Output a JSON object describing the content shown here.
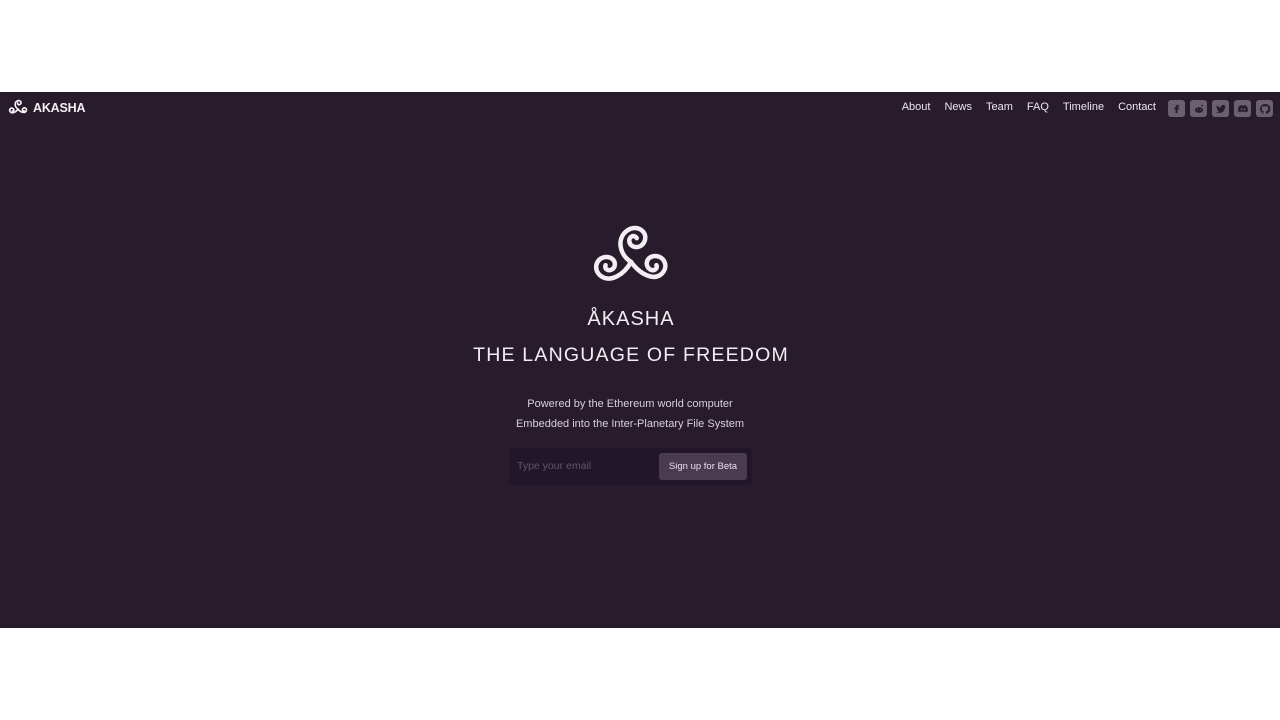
{
  "brand": {
    "name": "AKASHA",
    "logo_icon": "triskelion-icon"
  },
  "nav": {
    "links": [
      "About",
      "News",
      "Team",
      "FAQ",
      "Timeline",
      "Contact"
    ]
  },
  "social": [
    "facebook-icon",
    "reddit-icon",
    "twitter-icon",
    "discord-icon",
    "github-icon"
  ],
  "hero": {
    "name": "ÅKASHA",
    "tagline": "THE LANGUAGE OF FREEDOM",
    "subtitle_1": "Powered by the Ethereum world computer",
    "subtitle_2": "Embedded into the Inter-Planetary File System"
  },
  "signup": {
    "email_placeholder": "Type your email",
    "button_label": "Sign up for Beta"
  },
  "colors": {
    "background": "#271b2c",
    "text": "#f2eef3",
    "button": "#4a3b50",
    "social_icon": "#6b6070"
  }
}
